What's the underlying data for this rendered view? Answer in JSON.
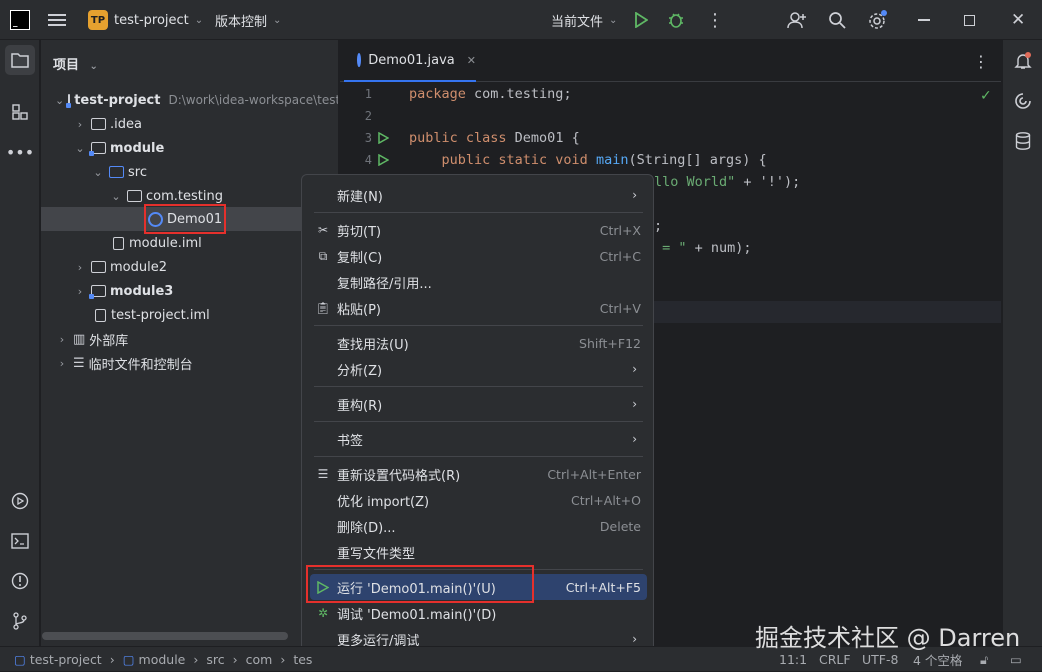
{
  "titlebar": {
    "project_badge": "TP",
    "project_name": "test-project",
    "vcs_label": "版本控制",
    "run_config": "当前文件"
  },
  "project_panel": {
    "title": "项目",
    "tree": [
      {
        "label": "test-project",
        "path": "D:\\work\\idea-workspace\\test"
      },
      {
        "label": ".idea"
      },
      {
        "label": "module"
      },
      {
        "label": "src"
      },
      {
        "label": "com.testing"
      },
      {
        "label": "Demo01"
      },
      {
        "label": "module.iml"
      },
      {
        "label": "module2"
      },
      {
        "label": "module3"
      },
      {
        "label": "test-project.iml"
      },
      {
        "label": "外部库"
      },
      {
        "label": "临时文件和控制台"
      }
    ]
  },
  "editor": {
    "tab_label": "Demo01.java",
    "line_numbers": [
      "1",
      "2",
      "3",
      "4"
    ],
    "code": {
      "l1_kw": "package",
      "l1_rest": " com.testing;",
      "l3_kw": "public class",
      "l3_rest": " Demo01 {",
      "l4_kw": "    public static void",
      "l4_fn": " main",
      "l4_rest": "(String[] args) {",
      "l5_str": "llo World\"",
      "l5_rest": " + '!');",
      "l6_rest": ";",
      "l7_str": " = \"",
      "l7_rest": " + num);"
    }
  },
  "context_menu": {
    "items": [
      {
        "label": "新建(N)",
        "shortcut": ""
      },
      {
        "label": "剪切(T)",
        "shortcut": "Ctrl+X"
      },
      {
        "label": "复制(C)",
        "shortcut": "Ctrl+C"
      },
      {
        "label": "复制路径/引用...",
        "shortcut": ""
      },
      {
        "label": "粘贴(P)",
        "shortcut": "Ctrl+V"
      },
      {
        "label": "查找用法(U)",
        "shortcut": "Shift+F12"
      },
      {
        "label": "分析(Z)",
        "shortcut": ""
      },
      {
        "label": "重构(R)",
        "shortcut": ""
      },
      {
        "label": "书签",
        "shortcut": ""
      },
      {
        "label": "重新设置代码格式(R)",
        "shortcut": "Ctrl+Alt+Enter"
      },
      {
        "label": "优化 import(Z)",
        "shortcut": "Ctrl+Alt+O"
      },
      {
        "label": "删除(D)...",
        "shortcut": "Delete"
      },
      {
        "label": "重写文件类型",
        "shortcut": ""
      },
      {
        "label": "运行 'Demo01.main()'(U)",
        "shortcut": "Ctrl+Alt+F5"
      },
      {
        "label": "调试 'Demo01.main()'(D)",
        "shortcut": ""
      },
      {
        "label": "更多运行/调试",
        "shortcut": ""
      }
    ]
  },
  "statusbar": {
    "breadcrumb": [
      "test-project",
      "module",
      "src",
      "com",
      "tes"
    ],
    "position": "11:1",
    "line_sep": "CRLF",
    "encoding": "UTF-8",
    "indent": "4 个空格"
  },
  "watermark": "掘金技术社区 @ Darren",
  "colors": {
    "accent": "#3574f0",
    "run_green": "#5fb865",
    "highlight_box": "#e5302c"
  }
}
